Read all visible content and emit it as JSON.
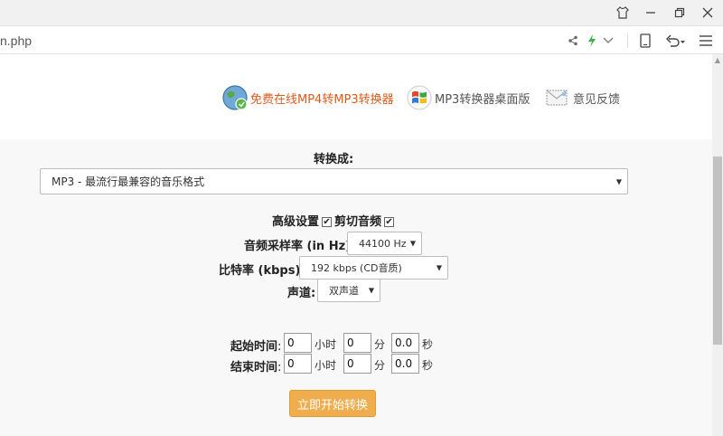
{
  "browser": {
    "url_fragment": "n.php"
  },
  "header": {
    "links": [
      {
        "label": "免费在线MP4转MP3转换器",
        "color": "#e05a1a"
      },
      {
        "label": "MP3转换器桌面版",
        "color": "#555555"
      },
      {
        "label": "意见反馈",
        "color": "#555555"
      }
    ]
  },
  "form": {
    "convert_to_label": "转换成:",
    "format_select": "MP3 - 最流行最兼容的音乐格式",
    "advanced_label": "高级设置",
    "cut_audio_label": "剪切音频",
    "sample_rate_label": "音频采样率 (in Hz):",
    "sample_rate_value": "44100 Hz",
    "bitrate_label": "比特率 (kbps):",
    "bitrate_value": "192 kbps (CD音质)",
    "channel_label": "声道:",
    "channel_value": "双声道",
    "start_time_label": "起始时间",
    "end_time_label": "结束时间",
    "colon": ":",
    "start": {
      "hours": "0",
      "minutes": "0",
      "seconds": "0.0"
    },
    "end": {
      "hours": "0",
      "minutes": "0",
      "seconds": "0.0"
    },
    "unit_hours": "小时",
    "unit_minutes": "分",
    "unit_seconds": "秒",
    "submit_label": "立即开始转换"
  },
  "checkmark": "✔"
}
